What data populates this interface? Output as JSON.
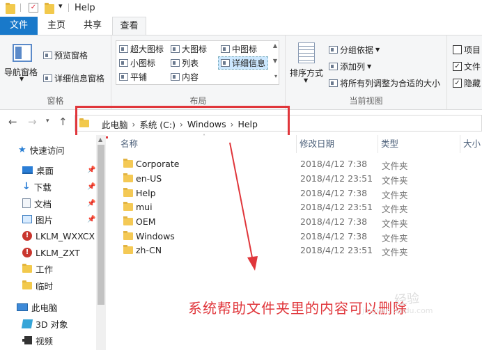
{
  "window": {
    "title": "Help"
  },
  "ribbon": {
    "tabs": [
      "文件",
      "主页",
      "共享",
      "查看"
    ],
    "panes": {
      "label": "窗格",
      "nav_pane": "导航窗格",
      "preview_pane": "预览窗格",
      "details_pane": "详细信息窗格"
    },
    "layout": {
      "label": "布局",
      "options": [
        "超大图标",
        "大图标",
        "中图标",
        "小图标",
        "列表",
        "详细信息",
        "平铺",
        "内容"
      ],
      "selected": "详细信息"
    },
    "current_view": {
      "label": "当前视图",
      "sort_by": "排序方式",
      "group_by": "分组依据",
      "add_columns": "添加列",
      "fit_columns": "将所有列调整为合适的大小"
    },
    "show_hide": {
      "items": [
        "项目",
        "文件",
        "隐藏"
      ],
      "checked": [
        false,
        true,
        true
      ]
    }
  },
  "address": {
    "crumbs": [
      "此电脑",
      "系统 (C:)",
      "Windows",
      "Help"
    ]
  },
  "nav_pane": {
    "items": [
      {
        "label": "快速访问",
        "icon": "star-icon",
        "pinned": false
      },
      {
        "label": "桌面",
        "icon": "desktop-icon",
        "pinned": true
      },
      {
        "label": "下载",
        "icon": "download-icon",
        "pinned": true
      },
      {
        "label": "文档",
        "icon": "document-icon",
        "pinned": true
      },
      {
        "label": "图片",
        "icon": "picture-icon",
        "pinned": true
      },
      {
        "label": "LKLM_WXXCX",
        "icon": "warning-icon",
        "pinned": false
      },
      {
        "label": "LKLM_ZXT",
        "icon": "warning-icon",
        "pinned": false
      },
      {
        "label": "工作",
        "icon": "folder-icon",
        "pinned": false
      },
      {
        "label": "临时",
        "icon": "folder-icon",
        "pinned": false
      },
      {
        "label": "此电脑",
        "icon": "computer-icon",
        "pinned": false
      },
      {
        "label": "3D 对象",
        "icon": "3d-objects-icon",
        "pinned": false
      },
      {
        "label": "视频",
        "icon": "video-icon",
        "pinned": false
      }
    ]
  },
  "file_list": {
    "columns": [
      "名称",
      "修改日期",
      "类型",
      "大小"
    ],
    "rows": [
      {
        "name": "Corporate",
        "date": "2018/4/12 7:38",
        "type": "文件夹"
      },
      {
        "name": "en-US",
        "date": "2018/4/12 23:51",
        "type": "文件夹"
      },
      {
        "name": "Help",
        "date": "2018/4/12 7:38",
        "type": "文件夹"
      },
      {
        "name": "mui",
        "date": "2018/4/12 23:51",
        "type": "文件夹"
      },
      {
        "name": "OEM",
        "date": "2018/4/12 7:38",
        "type": "文件夹"
      },
      {
        "name": "Windows",
        "date": "2018/4/12 7:38",
        "type": "文件夹"
      },
      {
        "name": "zh-CN",
        "date": "2018/4/12 23:51",
        "type": "文件夹"
      }
    ]
  },
  "annotation": {
    "text": "系统帮助文件夹里的内容可以删除",
    "color": "#e0363b"
  },
  "colors": {
    "accent": "#1979ca",
    "selection": "#cce8ff",
    "folder": "#f4c955"
  }
}
